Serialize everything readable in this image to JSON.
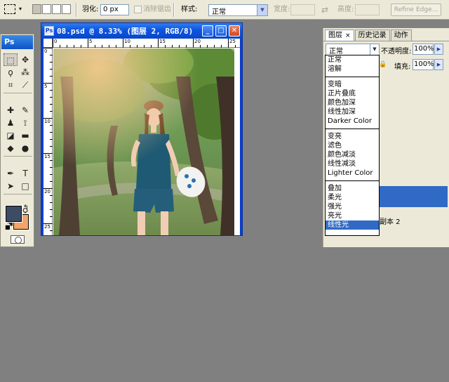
{
  "options_bar": {
    "feather_label": "羽化:",
    "feather_value": "0 px",
    "antialias_label": "消除锯齿",
    "style_label": "样式:",
    "style_value": "正常",
    "width_label": "宽度:",
    "height_label": "高度:",
    "swap_icon": "⇄",
    "refine_edge": "Refine Edge..."
  },
  "toolbox": {
    "logo": "Ps",
    "foreground_color": "#3c4c62",
    "background_color": "#f4a46a"
  },
  "document": {
    "title": "08.psd @ 8.33% (图层 2, RGB/8)",
    "ruler_top": [
      "0",
      "5",
      "10",
      "15",
      "20",
      "25"
    ],
    "ruler_left": [
      "0",
      "5",
      "10",
      "15",
      "20",
      "25"
    ]
  },
  "layers_panel": {
    "tabs": [
      "图层",
      "历史记录",
      "动作"
    ],
    "blend_mode": "正常",
    "opacity_label": "不透明度:",
    "opacity_value": "100%",
    "fill_label": "填充:",
    "fill_value": "100%",
    "layer_name_partial": "副本 2"
  },
  "blend_modes": {
    "group1": [
      "正常",
      "溶解"
    ],
    "group2": [
      "变暗",
      "正片叠底",
      "颜色加深",
      "线性加深",
      "Darker Color"
    ],
    "group3": [
      "变亮",
      "滤色",
      "颜色减淡",
      "线性减淡",
      "Lighter Color"
    ],
    "group4": [
      "叠加",
      "柔光",
      "强光",
      "亮光",
      "线性光"
    ]
  },
  "colors": {
    "selection": "#316ac5",
    "title_bar": "#0c55df",
    "workspace": "#808080"
  }
}
